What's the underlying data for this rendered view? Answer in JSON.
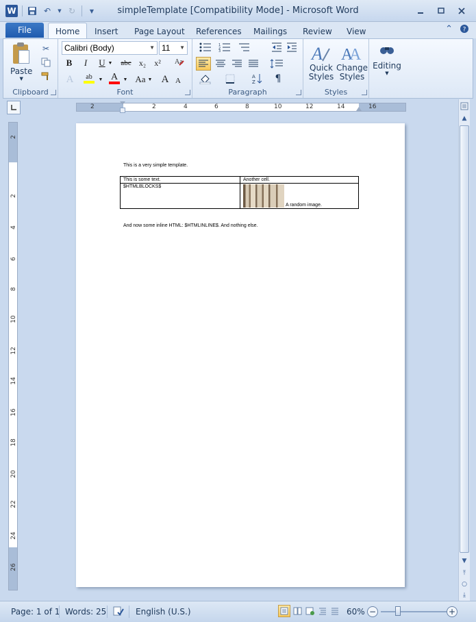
{
  "window": {
    "title": "simpleTemplate [Compatibility Mode]  -  Microsoft Word",
    "app_icon": "W",
    "quick_access": [
      "save-icon",
      "undo-icon",
      "redo-icon",
      "customize-icon"
    ]
  },
  "tabs": {
    "file": "File",
    "items": [
      "Home",
      "Insert",
      "Page Layout",
      "References",
      "Mailings",
      "Review",
      "View"
    ],
    "active": "Home"
  },
  "ribbon": {
    "clipboard": {
      "label": "Clipboard",
      "paste": "Paste"
    },
    "font": {
      "label": "Font",
      "family": "Calibri (Body)",
      "size": "11",
      "bold": "B",
      "italic": "I",
      "underline": "U",
      "strike": "abc",
      "subscript": "x₂",
      "superscript": "x²",
      "grow": "A",
      "shrink": "A",
      "change_case": "Aa",
      "font_color": "A",
      "highlight": "ab",
      "clear": "A",
      "highlight_color": "#ffff00",
      "font_color_value": "#ff0000"
    },
    "paragraph": {
      "label": "Paragraph",
      "pilcrow": "¶"
    },
    "styles": {
      "label": "Styles",
      "quick_styles": [
        "Quick",
        "Styles"
      ],
      "change_styles": [
        "Change",
        "Styles"
      ]
    },
    "editing": {
      "label": "Editing"
    }
  },
  "ruler": {
    "h_numbers": [
      "2",
      "2",
      "4",
      "6",
      "8",
      "10",
      "12",
      "14",
      "16"
    ],
    "v_numbers": [
      "2",
      "2",
      "4",
      "6",
      "8",
      "10",
      "12",
      "14",
      "16",
      "18",
      "20",
      "22",
      "24",
      "26"
    ]
  },
  "document": {
    "line1": "This is a very simple template.",
    "table": {
      "r1c1": "This is some text.",
      "r1c2": "Another cell.",
      "r2c1": "$HTMLBLOCKS$",
      "r2c2_caption": "A random image."
    },
    "line2": "And now some inline HTML: $HTMLINLINE$.  And nothing else."
  },
  "status": {
    "page": "Page: 1 of 1",
    "words": "Words: 25",
    "language": "English (U.S.)",
    "zoom": "60%"
  },
  "colors": {
    "accent": "#2b579a",
    "file_tab": "#1f5bae",
    "ribbon_bg": "#dde8f6",
    "window_bg": "#c9d9ee"
  }
}
